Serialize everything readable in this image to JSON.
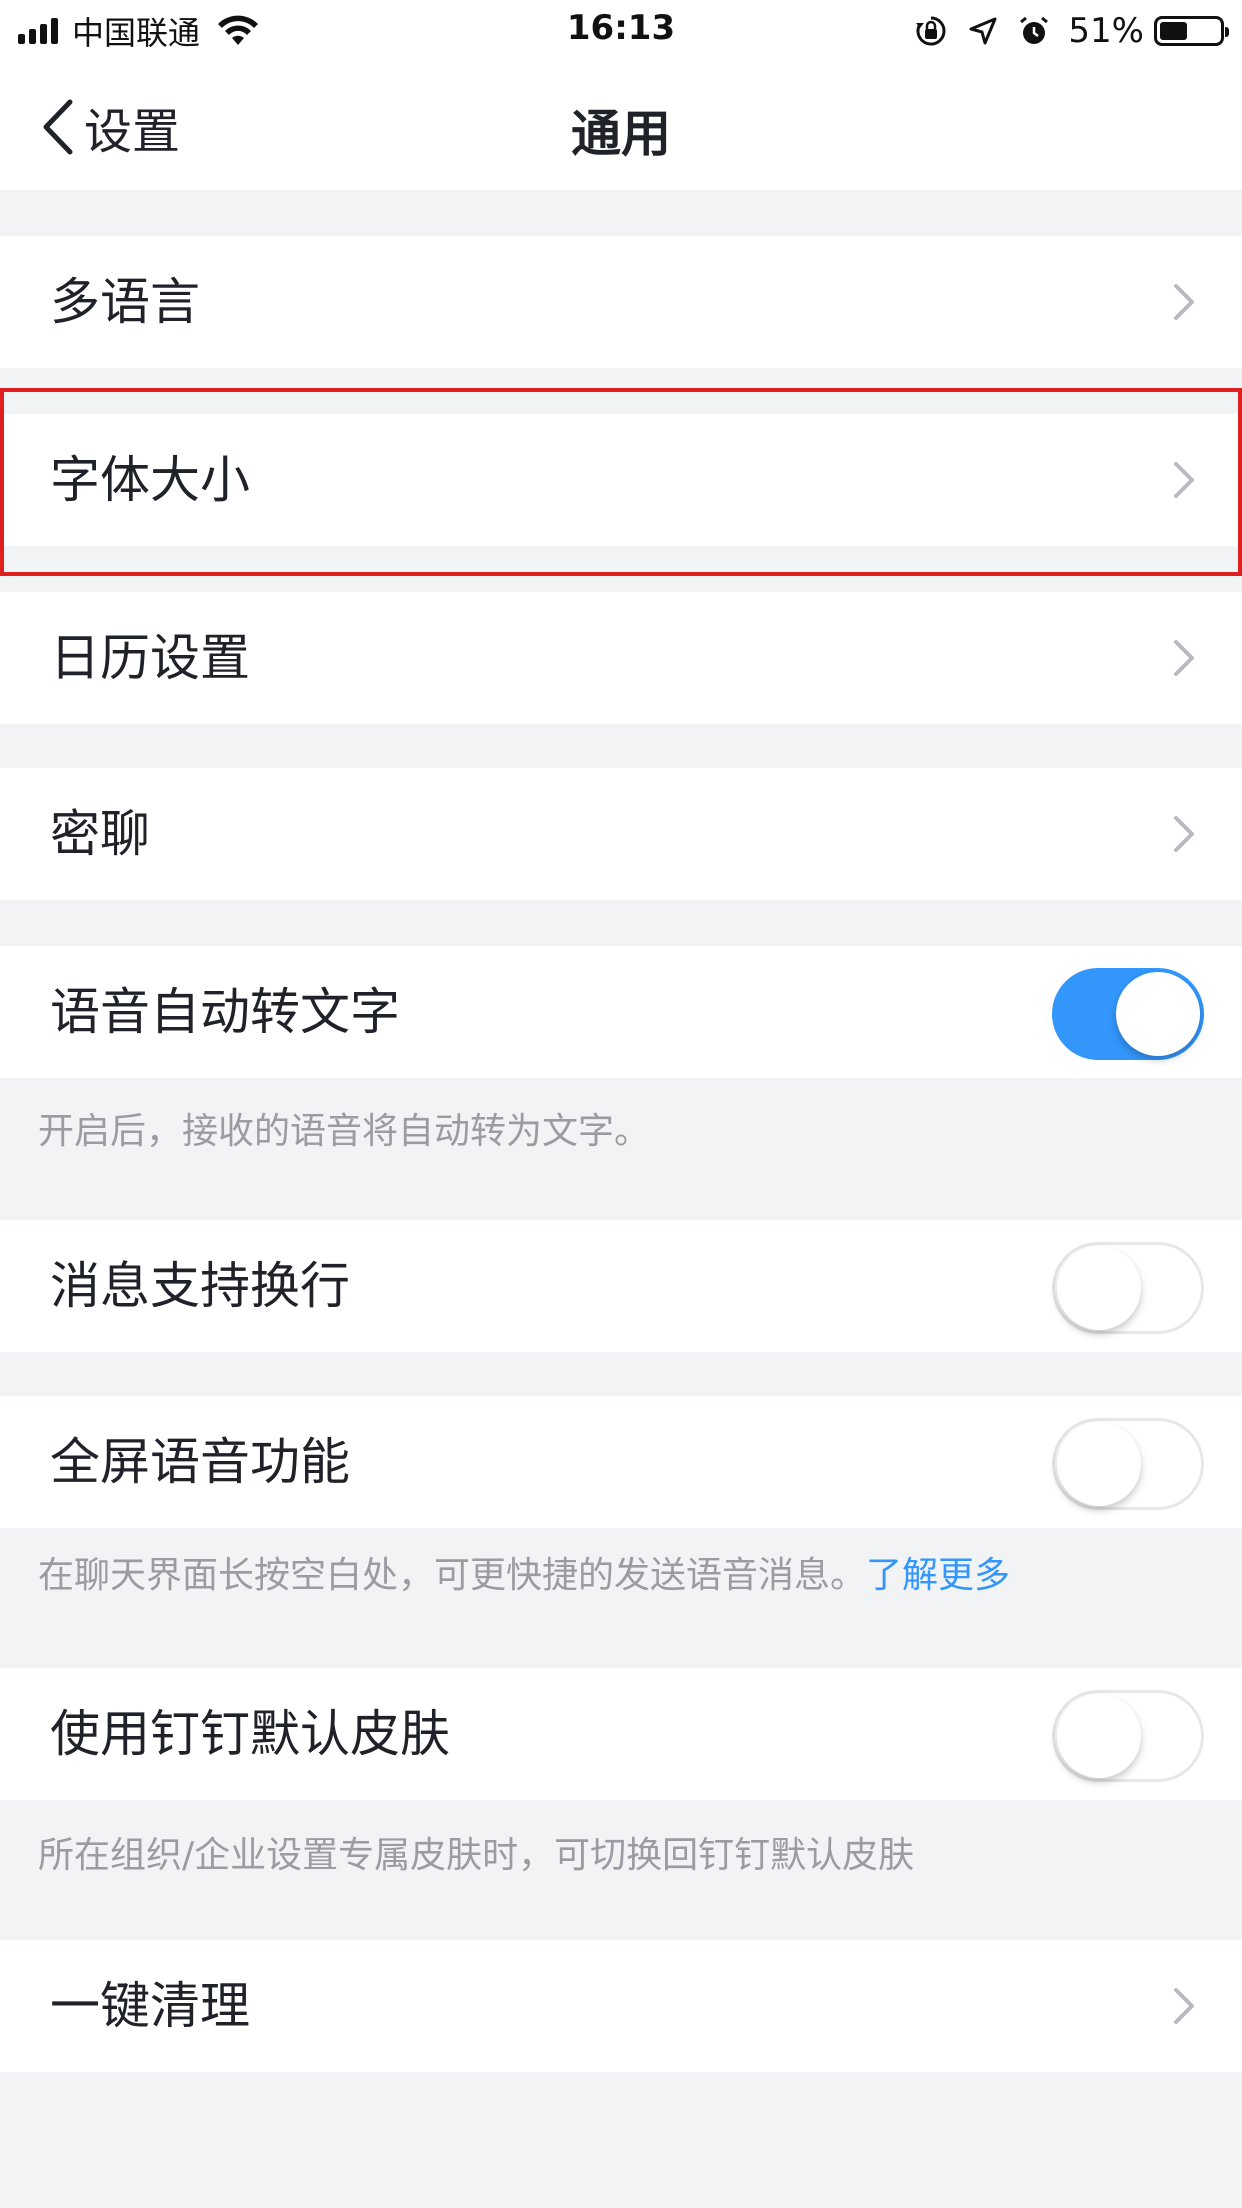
{
  "status_bar": {
    "carrier": "中国联通",
    "time": "16:13",
    "battery": "51%",
    "battery_level": 0.51
  },
  "nav": {
    "back_label": "设置",
    "title": "通用"
  },
  "settings": {
    "language": "多语言",
    "font_size": "字体大小",
    "calendar": "日历设置",
    "secret_chat": "密聊",
    "voice_to_text": {
      "label": "语音自动转文字",
      "enabled": true
    },
    "voice_to_text_desc": "开启后，接收的语音将自动转为文字。",
    "message_newline": {
      "label": "消息支持换行",
      "enabled": false
    },
    "fullscreen_voice": {
      "label": "全屏语音功能",
      "enabled": false
    },
    "fullscreen_voice_desc": "在聊天界面长按空白处，可更快捷的发送语音消息。",
    "fullscreen_voice_link": "了解更多",
    "default_skin": {
      "label": "使用钉钉默认皮肤",
      "enabled": false
    },
    "default_skin_desc": "所在组织/企业设置专属皮肤时，可切换回钉钉默认皮肤",
    "one_click_clean": "一键清理"
  },
  "colors": {
    "accent": "#3296fa",
    "highlight": "#e02020",
    "background": "#f2f3f5"
  }
}
